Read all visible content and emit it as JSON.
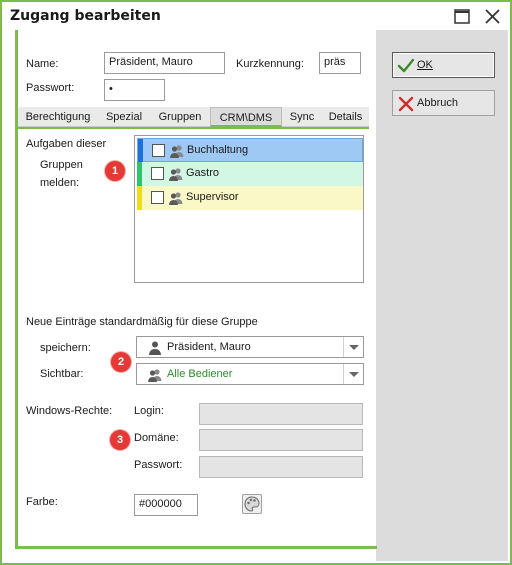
{
  "window": {
    "title": "Zugang bearbeiten"
  },
  "form": {
    "name_label": "Name:",
    "name_value": "Präsident, Mauro",
    "short_label": "Kurzkennung:",
    "short_value": "präs",
    "password_label": "Passwort:",
    "password_value": "•"
  },
  "tabs": [
    {
      "label": "Berechtigung",
      "active": false
    },
    {
      "label": "Spezial",
      "active": false
    },
    {
      "label": "Gruppen",
      "active": false
    },
    {
      "label": "CRM\\DMS",
      "active": true
    },
    {
      "label": "Sync",
      "active": false
    },
    {
      "label": "Details",
      "active": false
    }
  ],
  "groups_section": {
    "label_line1": "Aufgaben dieser",
    "label_line2": "Gruppen",
    "label_line3": "melden:",
    "items": [
      {
        "label": "Buchhaltung",
        "checked": false,
        "bar_color": "#1e6fd9",
        "row_color": "#9ec9f5",
        "selected": true
      },
      {
        "label": "Gastro",
        "checked": false,
        "bar_color": "#2fc46a",
        "row_color": "#d2f7e4",
        "selected": false
      },
      {
        "label": "Supervisor",
        "checked": false,
        "bar_color": "#f2dc1a",
        "row_color": "#fbf8c8",
        "selected": false
      }
    ]
  },
  "defaults_section": {
    "heading": "Neue Einträge standardmäßig für diese Gruppe",
    "save_label": "speichern:",
    "save_value": "Präsident, Mauro",
    "visible_label": "Sichtbar:",
    "visible_value": "Alle Bediener",
    "visible_value_color": "#2e8b2e"
  },
  "windows_rights": {
    "label": "Windows-Rechte:",
    "login_label": "Login:",
    "domain_label": "Domäne:",
    "password_label": "Passwort:",
    "login_value": "",
    "domain_value": "",
    "password_value": ""
  },
  "color_section": {
    "label": "Farbe:",
    "value": "#000000"
  },
  "badges": [
    "1",
    "2",
    "3"
  ],
  "buttons": {
    "ok": "OK",
    "cancel": "Abbruch"
  },
  "colors": {
    "accent": "#7dbb4b",
    "badge": "#e53935"
  }
}
